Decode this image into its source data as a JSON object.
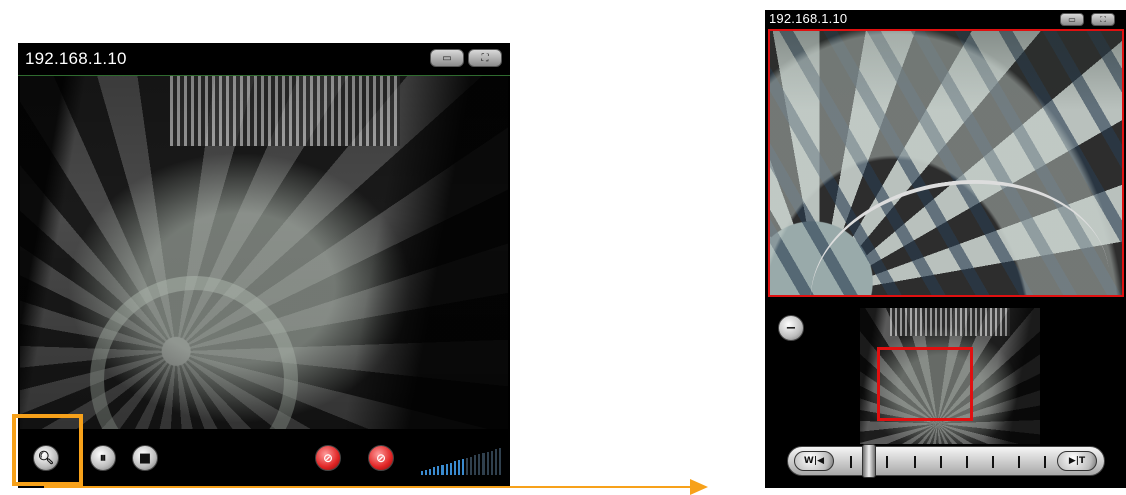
{
  "left_viewer": {
    "camera_address": "192.168.1.10",
    "title_buttons": [
      {
        "icon": "window-size-icon",
        "glyph": "▭"
      },
      {
        "icon": "fullscreen-icon",
        "glyph": "⛶"
      }
    ],
    "controls": [
      {
        "icon": "zoom-magnifier-icon",
        "glyph": "🔍︎"
      },
      {
        "icon": "pause-icon",
        "glyph": "⏸"
      },
      {
        "icon": "stop-icon",
        "glyph": "■"
      },
      {
        "icon": "record-off-icon",
        "glyph": "⊘"
      },
      {
        "icon": "mute-icon",
        "glyph": "⊘"
      }
    ],
    "volume_level": 0.55,
    "highlight_color": "#f7a11a"
  },
  "right_viewer": {
    "camera_address": "192.168.1.10",
    "title_buttons": [
      {
        "icon": "window-size-icon",
        "glyph": "▭"
      },
      {
        "icon": "fullscreen-icon",
        "glyph": "⛶"
      }
    ],
    "zoom_icon": {
      "icon": "zoom-out-icon",
      "glyph": "−"
    },
    "slider": {
      "wide_label": "W",
      "tele_label": "T",
      "level": 0.0
    },
    "roi_color": "#e01010"
  }
}
